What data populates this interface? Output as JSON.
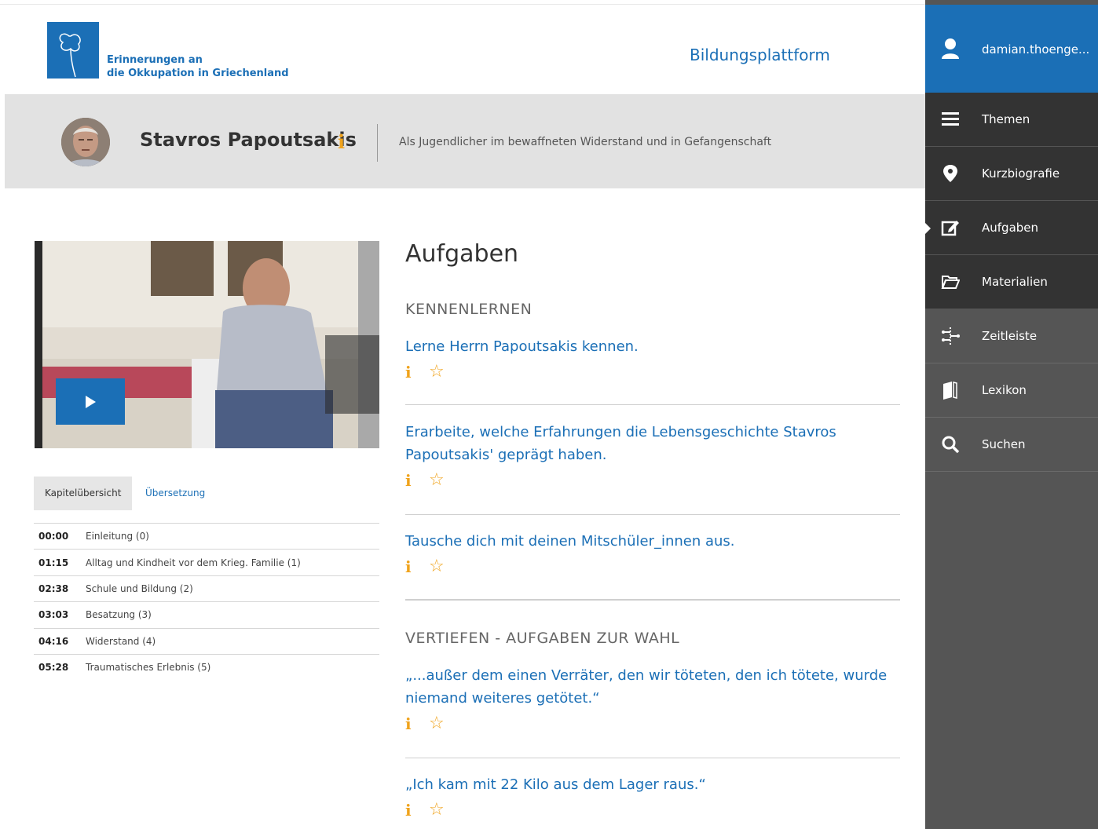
{
  "header": {
    "logo_line1": "Erinnerungen an",
    "logo_line2": "die Okkupation in Griechenland",
    "platform_label": "Bildungsplattform"
  },
  "person": {
    "name": "Stavros Papoutsakis",
    "info": "i",
    "subtitle": "Als Jugendlicher im bewaffneten Widerstand und in Gefangenschaft"
  },
  "video": {
    "play_icon": "play-icon"
  },
  "tabs": [
    {
      "label": "Kapitelübersicht",
      "active": true
    },
    {
      "label": "Übersetzung",
      "active": false
    }
  ],
  "chapters": [
    {
      "time": "00:00",
      "title": "Einleitung (0)"
    },
    {
      "time": "01:15",
      "title": "Alltag und Kindheit vor dem Krieg. Familie (1)"
    },
    {
      "time": "02:38",
      "title": "Schule und Bildung (2)"
    },
    {
      "time": "03:03",
      "title": "Besatzung (3)"
    },
    {
      "time": "04:16",
      "title": "Widerstand (4)"
    },
    {
      "time": "05:28",
      "title": "Traumatisches Erlebnis (5)"
    }
  ],
  "main": {
    "title": "Aufgaben",
    "sections": [
      {
        "heading": "KENNENLERNEN",
        "tasks": [
          {
            "text": "Lerne Herrn Papoutsakis kennen."
          },
          {
            "text": "Erarbeite, welche Erfahrungen die Lebensgeschichte Stavros Papoutsakis' geprägt haben."
          },
          {
            "text": "Tausche dich mit deinen Mitschüler_innen aus."
          }
        ]
      },
      {
        "heading": "VERTIEFEN - AUFGABEN ZUR WAHL",
        "tasks": [
          {
            "text": "„...außer dem einen Verräter, den wir töteten, den ich tötete, wurde niemand weiteres getötet.“"
          },
          {
            "text": "„Ich kam mit 22 Kilo aus dem Lager raus.“"
          }
        ]
      }
    ],
    "info_glyph": "i",
    "star_glyph": "☆"
  },
  "sidebar": {
    "user": "damian.thoenge...",
    "items": [
      {
        "label": "Themen",
        "icon": "menu-icon"
      },
      {
        "label": "Kurzbiografie",
        "icon": "map-pin-icon"
      },
      {
        "label": "Aufgaben",
        "icon": "edit-icon"
      },
      {
        "label": "Materialien",
        "icon": "folder-icon"
      },
      {
        "label": "Zeitleiste",
        "icon": "timeline-icon"
      },
      {
        "label": "Lexikon",
        "icon": "book-icon"
      },
      {
        "label": "Suchen",
        "icon": "search-icon"
      }
    ]
  },
  "colors": {
    "brand_blue": "#1b6fb6",
    "accent_orange": "#f0a31c",
    "sidebar_gray": "#555555",
    "sidebar_dark": "#333333"
  }
}
